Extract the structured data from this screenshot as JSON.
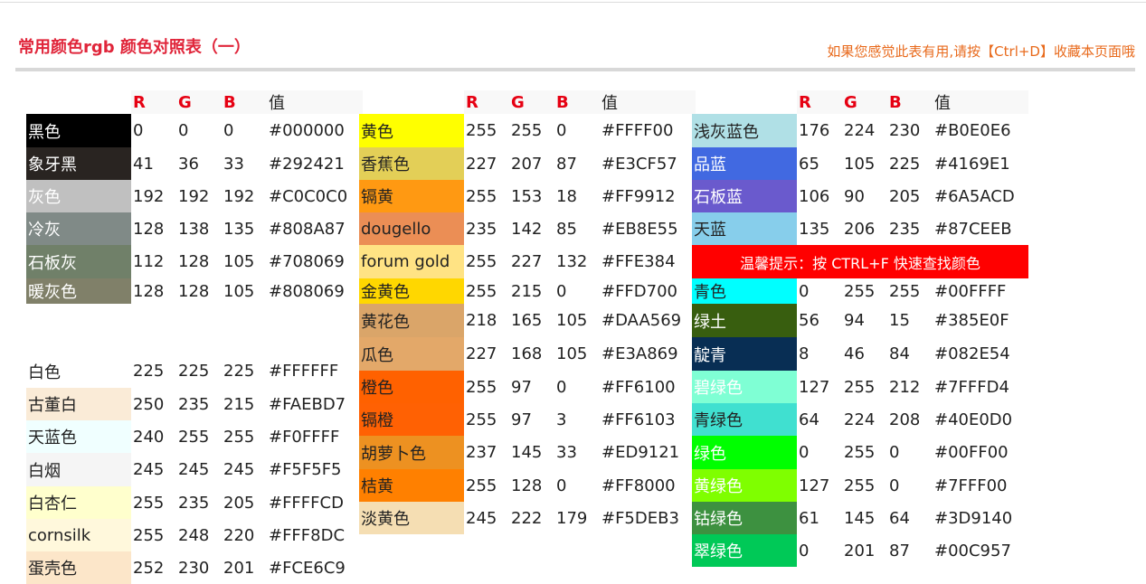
{
  "header": {
    "title": "常用颜色rgb 颜色对照表（一）",
    "bookmark_tip": "如果您感觉此表有用,请按【Ctrl+D】收藏本页面哦"
  },
  "table_header": {
    "r": "R",
    "g": "G",
    "b": "B",
    "value": "值"
  },
  "columns": [
    {
      "rows": [
        {
          "name": "黑色",
          "r": "0",
          "g": "0",
          "b": "0",
          "hex": "#000000",
          "bg": "#000000",
          "fg": "#ffffff",
          "h": 37
        },
        {
          "name": "象牙黑",
          "r": "41",
          "g": "36",
          "b": "33",
          "hex": "#292421",
          "bg": "#292421",
          "fg": "#ffffff",
          "h": 36
        },
        {
          "name": "灰色",
          "r": "192",
          "g": "192",
          "b": "192",
          "hex": "#C0C0C0",
          "bg": "#C0C0C0",
          "fg": "#ffffff",
          "h": 36
        },
        {
          "name": "冷灰",
          "r": "128",
          "g": "138",
          "b": "135",
          "hex": "#808A87",
          "bg": "#808A87",
          "fg": "#ffffff",
          "h": 36
        },
        {
          "name": "石板灰",
          "r": "112",
          "g": "128",
          "b": "105",
          "hex": "#708069",
          "bg": "#708069",
          "fg": "#ffffff",
          "h": 37
        },
        {
          "name": "暖灰色",
          "r": "128",
          "g": "128",
          "b": "105",
          "hex": "#808069",
          "bg": "#808069",
          "fg": "#ffffff",
          "h": 28
        },
        {
          "name": "",
          "r": "",
          "g": "",
          "b": "",
          "hex": "",
          "bg": "",
          "fg": "",
          "h": 56
        },
        {
          "name": "白色",
          "r": "225",
          "g": "225",
          "b": "225",
          "hex": "#FFFFFF",
          "bg": "#FFFFFF",
          "fg": "#222222",
          "h": 37
        },
        {
          "name": "古董白",
          "r": "250",
          "g": "235",
          "b": "215",
          "hex": "#FAEBD7",
          "bg": "#FAEBD7",
          "fg": "#222222",
          "h": 36
        },
        {
          "name": "天蓝色",
          "r": "240",
          "g": "255",
          "b": "255",
          "hex": "#F0FFFF",
          "bg": "#F0FFFF",
          "fg": "#222222",
          "h": 36
        },
        {
          "name": "白烟",
          "r": "245",
          "g": "245",
          "b": "245",
          "hex": "#F5F5F5",
          "bg": "#F5F5F5",
          "fg": "#222222",
          "h": 37
        },
        {
          "name": "白杏仁",
          "r": "255",
          "g": "235",
          "b": "205",
          "hex": "#FFFFCD",
          "bg": "#FFFFCD",
          "fg": "#222222",
          "h": 36
        },
        {
          "name": "cornsilk",
          "r": "255",
          "g": "248",
          "b": "220",
          "hex": "#FFF8DC",
          "bg": "#FFF8DC",
          "fg": "#222222",
          "h": 36
        },
        {
          "name": "蛋壳色",
          "r": "252",
          "g": "230",
          "b": "201",
          "hex": "#FCE6C9",
          "bg": "#FCE6C9",
          "fg": "#222222",
          "h": 36
        }
      ]
    },
    {
      "rows": [
        {
          "name": "黄色",
          "r": "255",
          "g": "255",
          "b": "0",
          "hex": "#FFFF00",
          "bg": "#FFFF00",
          "fg": "#222222",
          "h": 37
        },
        {
          "name": "香蕉色",
          "r": "227",
          "g": "207",
          "b": "87",
          "hex": "#E3CF57",
          "bg": "#E3CF57",
          "fg": "#222222",
          "h": 36
        },
        {
          "name": "镉黄",
          "r": "255",
          "g": "153",
          "b": "18",
          "hex": "#FF9912",
          "bg": "#FF9912",
          "fg": "#222222",
          "h": 36
        },
        {
          "name": "dougello",
          "r": "235",
          "g": "142",
          "b": "85",
          "hex": "#EB8E55",
          "bg": "#EB8E55",
          "fg": "#222222",
          "h": 36
        },
        {
          "name": "forum gold",
          "r": "255",
          "g": "227",
          "b": "132",
          "hex": "#FFE384",
          "bg": "#FFE384",
          "fg": "#222222",
          "h": 37
        },
        {
          "name": "金黄色",
          "r": "255",
          "g": "215",
          "b": "0",
          "hex": "#FFD700",
          "bg": "#FFD700",
          "fg": "#222222",
          "h": 28
        },
        {
          "name": "黄花色",
          "r": "218",
          "g": "165",
          "b": "105",
          "hex": "#DAA569",
          "bg": "#DAA569",
          "fg": "#222222",
          "h": 37
        },
        {
          "name": "瓜色",
          "r": "227",
          "g": "168",
          "b": "105",
          "hex": "#E3A869",
          "bg": "#E3A869",
          "fg": "#222222",
          "h": 37
        },
        {
          "name": "橙色",
          "r": "255",
          "g": "97",
          "b": "0",
          "hex": "#FF6100",
          "bg": "#FF6100",
          "fg": "#222222",
          "h": 36
        },
        {
          "name": "镉橙",
          "r": "255",
          "g": "97",
          "b": "3",
          "hex": "#FF6103",
          "bg": "#FF6103",
          "fg": "#222222",
          "h": 36
        },
        {
          "name": "胡萝卜色",
          "r": "237",
          "g": "145",
          "b": "33",
          "hex": "#ED9121",
          "bg": "#ED9121",
          "fg": "#222222",
          "h": 37
        },
        {
          "name": "桔黄",
          "r": "255",
          "g": "128",
          "b": "0",
          "hex": "#FF8000",
          "bg": "#FF8000",
          "fg": "#222222",
          "h": 36
        },
        {
          "name": "淡黄色",
          "r": "245",
          "g": "222",
          "b": "179",
          "hex": "#F5DEB3",
          "bg": "#F5DEB3",
          "fg": "#222222",
          "h": 36
        }
      ]
    },
    {
      "rows": [
        {
          "name": "浅灰蓝色",
          "r": "176",
          "g": "224",
          "b": "230",
          "hex": "#B0E0E6",
          "bg": "#B0E0E6",
          "fg": "#222222",
          "h": 37
        },
        {
          "name": "品蓝",
          "r": "65",
          "g": "105",
          "b": "225",
          "hex": "#4169E1",
          "bg": "#4169E1",
          "fg": "#ffffff",
          "h": 36
        },
        {
          "name": "石板蓝",
          "r": "106",
          "g": "90",
          "b": "205",
          "hex": "#6A5ACD",
          "bg": "#6A5ACD",
          "fg": "#ffffff",
          "h": 36
        },
        {
          "name": "天蓝",
          "r": "135",
          "g": "206",
          "b": "235",
          "hex": "#87CEEB",
          "bg": "#87CEEB",
          "fg": "#222222",
          "h": 36
        },
        {
          "warm": "温馨提示：按 CTRL+F 快速查找颜色",
          "h": 37
        },
        {
          "name": "青色",
          "r": "0",
          "g": "255",
          "b": "255",
          "hex": "#00FFFF",
          "bg": "#00FFFF",
          "fg": "#222222",
          "h": 28
        },
        {
          "name": "绿土",
          "r": "56",
          "g": "94",
          "b": "15",
          "hex": "#385E0F",
          "bg": "#385E0F",
          "fg": "#ffffff",
          "h": 37
        },
        {
          "name": "靛青",
          "r": "8",
          "g": "46",
          "b": "84",
          "hex": "#082E54",
          "bg": "#082E54",
          "fg": "#ffffff",
          "h": 37
        },
        {
          "name": "碧绿色",
          "r": "127",
          "g": "255",
          "b": "212",
          "hex": "#7FFFD4",
          "bg": "#7FFFD4",
          "fg": "#ffffff",
          "h": 36
        },
        {
          "name": "青绿色",
          "r": "64",
          "g": "224",
          "b": "208",
          "hex": "#40E0D0",
          "bg": "#40E0D0",
          "fg": "#222222",
          "h": 36
        },
        {
          "name": "绿色",
          "r": "0",
          "g": "255",
          "b": "0",
          "hex": "#00FF00",
          "bg": "#00FF00",
          "fg": "#ffffff",
          "h": 37
        },
        {
          "name": "黄绿色",
          "r": "127",
          "g": "255",
          "b": "0",
          "hex": "#7FFF00",
          "bg": "#7FFF00",
          "fg": "#ffffff",
          "h": 36
        },
        {
          "name": "钴绿色",
          "r": "61",
          "g": "145",
          "b": "64",
          "hex": "#3D9140",
          "bg": "#3D9140",
          "fg": "#ffffff",
          "h": 36
        },
        {
          "name": "翠绿色",
          "r": "0",
          "g": "201",
          "b": "87",
          "hex": "#00C957",
          "bg": "#00C957",
          "fg": "#ffffff",
          "h": 36
        }
      ]
    }
  ]
}
